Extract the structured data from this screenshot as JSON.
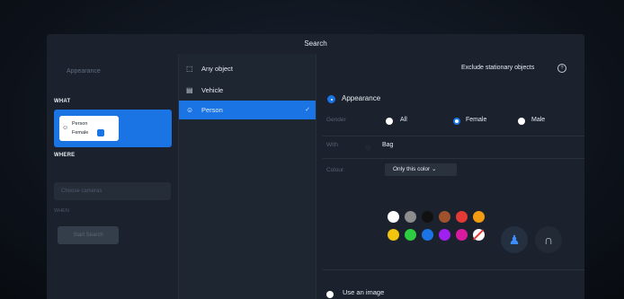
{
  "modal": {
    "title": "Search"
  },
  "left": {
    "crumb": "Appearance",
    "what_label": "WHAT",
    "what_chip": {
      "line1": "Person",
      "line2": "Female",
      "icon": "person-icon"
    },
    "where_label": "WHERE",
    "where_placeholder": "Choose cameras",
    "when_label": "WHEN",
    "action_button": "Start Search"
  },
  "object_types": [
    {
      "label": "Any object",
      "icon": "dashed-square-icon",
      "active": false
    },
    {
      "label": "Vehicle",
      "icon": "car-icon",
      "active": false
    },
    {
      "label": "Person",
      "icon": "person-icon",
      "active": true
    }
  ],
  "right": {
    "exclude_label": "Exclude stationary objects",
    "help_glyph": "?",
    "appearance_label": "Appearance",
    "gender": {
      "label": "Gender",
      "options": [
        "All",
        "Female",
        "Male"
      ],
      "selected": "Female"
    },
    "with": {
      "label": "With",
      "value": "Bag"
    },
    "color": {
      "label": "Colour",
      "mode": "Only this color ⌄",
      "swatches_row1": [
        "#ffffff",
        "#8d8d8d",
        "#111111",
        "#a0522d",
        "#e53935",
        "#f39c12"
      ],
      "swatches_row2": [
        "#f1c40f",
        "#2ecc40",
        "#1b74e4",
        "#a020f0",
        "#d81b9e",
        "none"
      ]
    },
    "use_image_label": "Use an image"
  },
  "colors": {
    "accent": "#1b74e4",
    "panel": "#1b222d",
    "background": "#0b1017"
  }
}
